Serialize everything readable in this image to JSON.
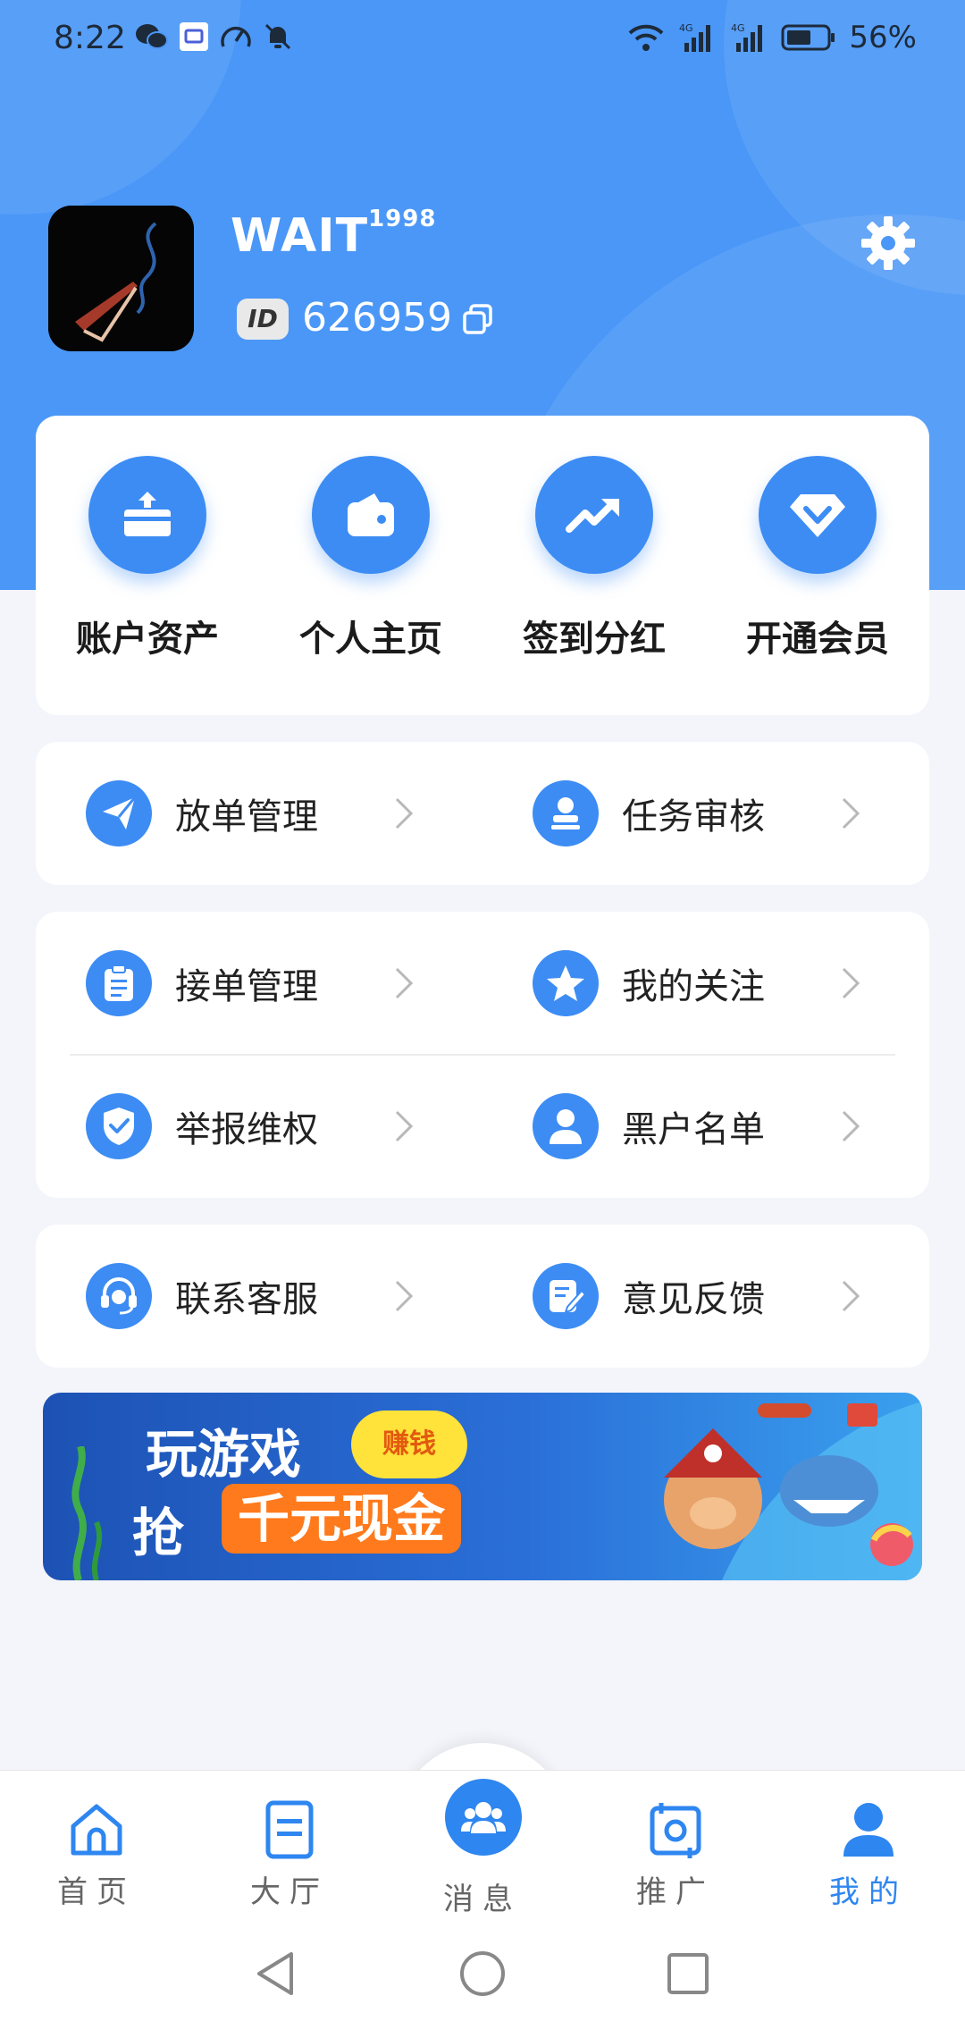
{
  "status_bar": {
    "time": "8:22",
    "battery": "56%",
    "network_1": "4G",
    "network_2": "4G"
  },
  "profile": {
    "username": "WAIT",
    "username_sup": "1998",
    "id_badge": "ID",
    "user_id": "626959"
  },
  "quick_actions": [
    {
      "label": "账户资产",
      "icon": "card-upload-icon"
    },
    {
      "label": "个人主页",
      "icon": "wallet-icon"
    },
    {
      "label": "签到分红",
      "icon": "trend-up-icon"
    },
    {
      "label": "开通会员",
      "icon": "diamond-icon"
    }
  ],
  "menu": {
    "group1": [
      {
        "label": "放单管理",
        "icon": "send-icon"
      },
      {
        "label": "任务审核",
        "icon": "stamp-icon"
      }
    ],
    "group2": [
      {
        "label": "接单管理",
        "icon": "clipboard-icon"
      },
      {
        "label": "我的关注",
        "icon": "star-icon"
      },
      {
        "label": "举报维权",
        "icon": "shield-check-icon"
      },
      {
        "label": "黑户名单",
        "icon": "user-icon"
      }
    ],
    "group3": [
      {
        "label": "联系客服",
        "icon": "headset-icon"
      },
      {
        "label": "意见反馈",
        "icon": "edit-icon"
      }
    ]
  },
  "banner": {
    "line1": "玩游戏",
    "line2_prefix": "抢",
    "highlight": "千元现金",
    "tag": "赚钱"
  },
  "bottom_nav": [
    {
      "label": "首页",
      "icon": "home-icon"
    },
    {
      "label": "大厅",
      "icon": "document-icon"
    },
    {
      "label": "消息",
      "icon": "group-icon"
    },
    {
      "label": "推广",
      "icon": "share-icon"
    },
    {
      "label": "我的",
      "icon": "person-icon",
      "active": true
    }
  ],
  "colors": {
    "primary": "#3c8cf4",
    "header": "#4a97f7",
    "active_nav": "#2e86f0"
  }
}
